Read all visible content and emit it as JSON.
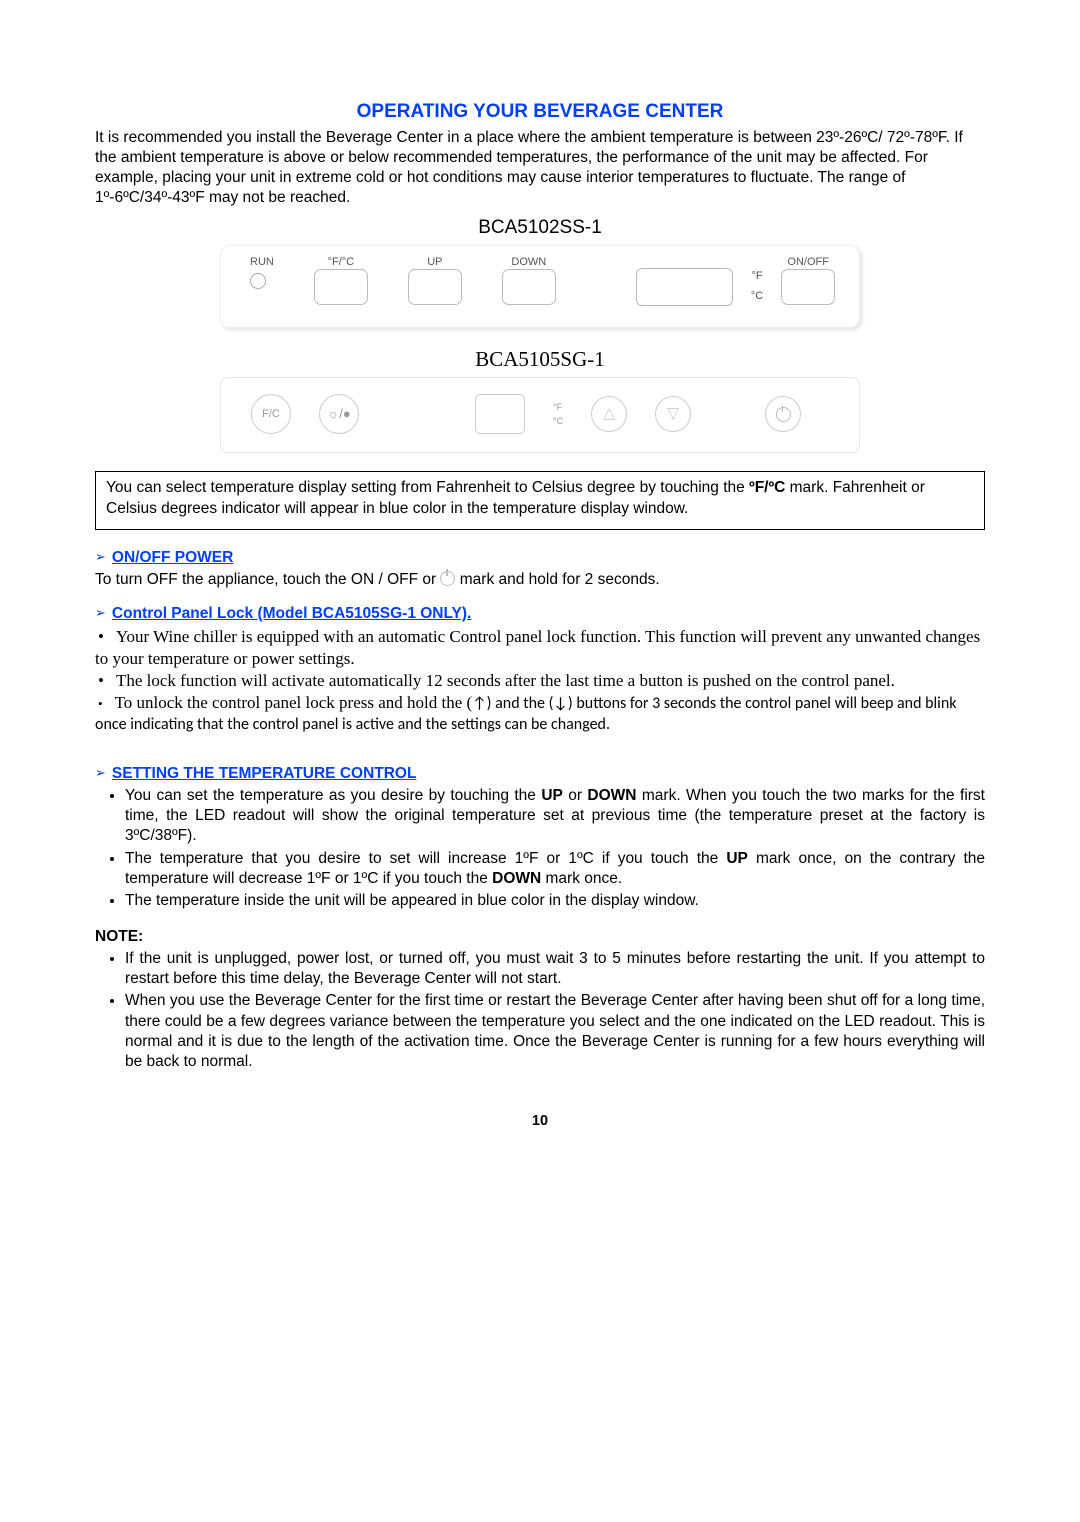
{
  "title": "OPERATING YOUR BEVERAGE CENTER",
  "intro": "It is recommended you install the Beverage Center in a place where the ambient temperature is between 23º-26ºC/ 72º-78ºF.  If the ambient temperature is above or below recommended temperatures, the performance of the unit may be affected.  For example, placing your unit in extreme cold or hot conditions may cause interior temperatures to fluctuate.  The range of 1º-6ºC/34º-43ºF may not be reached.",
  "panel1": {
    "model": "BCA5102SS-1",
    "run": "RUN",
    "fc": "°F/°C",
    "up": "UP",
    "down": "DOWN",
    "onoff": "ON/OFF",
    "degF": "°F",
    "degC": "°C"
  },
  "panel2": {
    "model": "BCA5105SG-1",
    "fc": "F/C",
    "degF": "°F",
    "degC": "°C"
  },
  "note_box": {
    "before": "You can select temperature display setting from Fahrenheit to Celsius degree by touching the ",
    "mark": "ºF/ºC",
    "after": " mark.  Fahrenheit or Celsius degrees indicator will appear in blue color in the temperature display window."
  },
  "onoff_power": {
    "heading": "ON/OFF POWER",
    "body_before": "To turn OFF the appliance, touch the ON / OFF or  ",
    "body_after": "  mark and hold for 2 seconds."
  },
  "cpl": {
    "heading": "Control Panel Lock (Model BCA5105SG-1 ONLY).",
    "b1": "Your Wine chiller is equipped with an automatic Control panel lock function.  This function will prevent any unwanted changes to your temperature or power settings.",
    "b2": "The lock function will activate automatically 12 seconds after the last time a button is pushed on the control panel.",
    "b3_a": "To unlock the control panel lock press and hold the (",
    "b3_up": "↑",
    "b3_mid": ") and the (",
    "b3_down": "↓",
    "b3_c": ") buttons for 3 seconds the control panel will beep and blink once indicating that the control panel is active and the settings can be changed."
  },
  "stc": {
    "heading": "SETTING THE TEMPERATURE CONTROL",
    "b1_a": "You can set the temperature as you desire by touching the ",
    "b1_up": "UP",
    "b1_or": " or ",
    "b1_down": "DOWN",
    "b1_b": " mark. When you touch the two marks for the first time, the LED readout will show the original temperature set at previous time (the temperature preset at the factory is 3ºC/38ºF).",
    "b2_a": "The temperature that you desire to set will increase 1ºF or 1ºC if you touch the ",
    "b2_up": "UP",
    "b2_b": " mark once, on the contrary the temperature will decrease 1ºF or 1ºC if you touch the ",
    "b2_down": "DOWN",
    "b2_c": " mark once.",
    "b3": "The temperature inside the unit will be appeared in blue color in the display window."
  },
  "note": {
    "heading": "NOTE:",
    "b1": "If the unit is unplugged, power lost, or turned off, you must wait 3 to 5 minutes before restarting the unit. If you attempt to restart before this time delay, the Beverage Center will not start.",
    "b2": "When you use the Beverage Center for the first time or restart the Beverage Center after having been shut off for a long time, there could be a few degrees variance between the temperature you select and the one indicated on the LED readout.  This is normal and it is due to the length of the activation time. Once the Beverage Center is running for a few hours everything will be back to normal."
  },
  "page_number": "10"
}
